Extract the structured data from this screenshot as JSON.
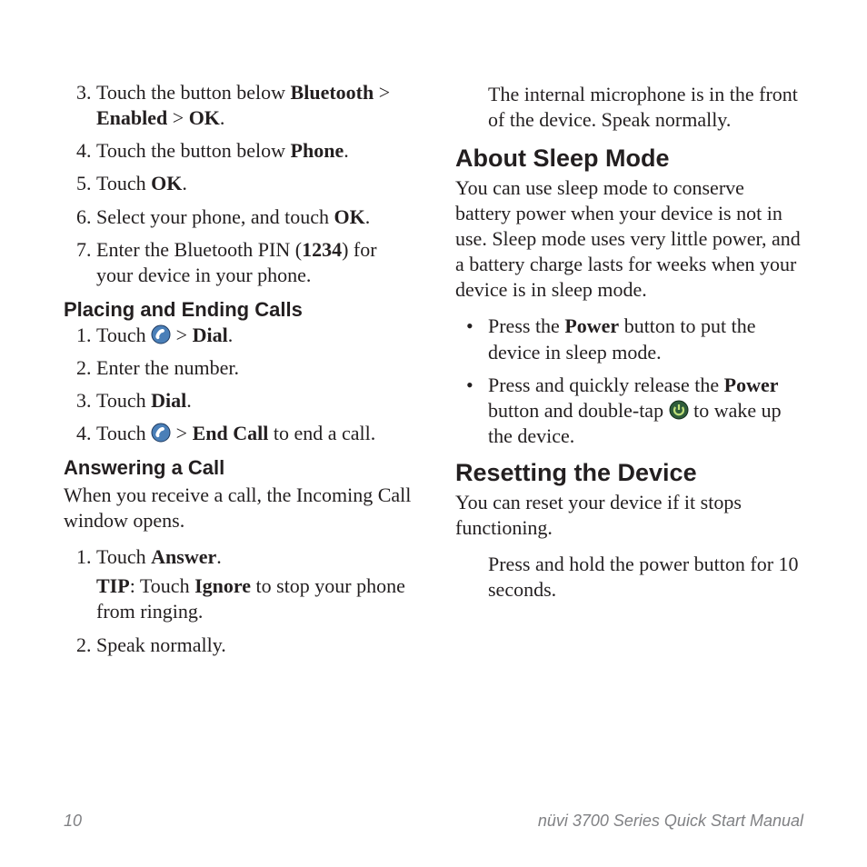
{
  "col1": {
    "ol1": [
      {
        "n": "3.",
        "html": "Touch the button below <span class='bold'>Bluetooth</span> > <span class='bold'>Enabled</span> > <span class='bold'>OK</span>."
      },
      {
        "n": "4.",
        "html": "Touch the button below <span class='bold'>Phone</span>."
      },
      {
        "n": "5.",
        "html": "Touch <span class='bold'>OK</span>."
      },
      {
        "n": "6.",
        "html": "Select your phone, and touch <span class='bold'>OK</span>."
      },
      {
        "n": "7.",
        "html": "Enter the Bluetooth PIN (<span class='bold'>1234</span>) for your device in your phone."
      }
    ],
    "sub1": "Placing and Ending Calls",
    "ol2": [
      {
        "n": "1.",
        "html": "Touch {PHONE} > <span class='bold'>Dial</span>."
      },
      {
        "n": "2.",
        "html": "Enter the number."
      },
      {
        "n": "3.",
        "html": "Touch <span class='bold'>Dial</span>."
      },
      {
        "n": "4.",
        "html": "Touch {PHONE} > <span class='bold'>End Call</span> to end a call."
      }
    ],
    "sub2": "Answering a Call",
    "p1": "When you receive a call, the Incoming Call window opens.",
    "ol3": [
      {
        "n": "1.",
        "html": "Touch <span class='bold'>Answer</span>.",
        "tip": "<span class='bold'>TIP</span>: Touch <span class='bold'>Ignore</span> to stop your phone from ringing."
      },
      {
        "n": "2.",
        "html": "Speak normally."
      }
    ]
  },
  "col2": {
    "hanging1": "The internal microphone is in the front of the device. Speak normally.",
    "h1": "About Sleep Mode",
    "p1": "You can use sleep mode to conserve battery power when your device is not in use. Sleep mode uses very little power, and a battery charge lasts for weeks when your device is in sleep mode.",
    "ul1": [
      {
        "html": "Press the <span class='bold'>Power</span> button to put the device in sleep mode."
      },
      {
        "html": "Press and quickly release the <span class='bold'>Power</span> button and double-tap {POWER} to wake up the device."
      }
    ],
    "h2": "Resetting the Device",
    "p2": "You can reset your device if it stops functioning.",
    "hanging2": "Press and hold the power button for 10 seconds."
  },
  "footer": {
    "page": "10",
    "title": "nüvi 3700 Series Quick Start Manual"
  }
}
